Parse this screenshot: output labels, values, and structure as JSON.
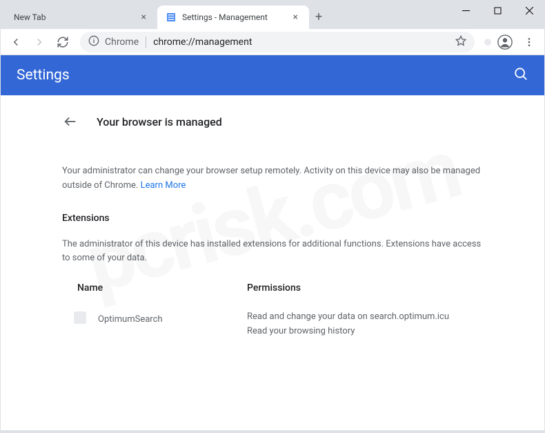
{
  "tabs": [
    {
      "title": "New Tab",
      "icon": "blank",
      "active": false
    },
    {
      "title": "Settings - Management",
      "icon": "settings",
      "active": true
    }
  ],
  "addressBar": {
    "scheme": "Chrome",
    "url": "chrome://management"
  },
  "settings": {
    "headerTitle": "Settings",
    "pageTitle": "Your browser is managed",
    "infoText": "Your administrator can change your browser setup remotely. Activity on this device may also be managed outside of Chrome. ",
    "learnMore": "Learn More",
    "extensionsTitle": "Extensions",
    "extensionsDesc": "The administrator of this device has installed extensions for additional functions. Extensions have access to some of your data.",
    "columns": {
      "name": "Name",
      "permissions": "Permissions"
    },
    "extensions": [
      {
        "name": "OptimumSearch",
        "permissions": "Read and change your data on search.optimum.icu\nRead your browsing history"
      }
    ]
  }
}
